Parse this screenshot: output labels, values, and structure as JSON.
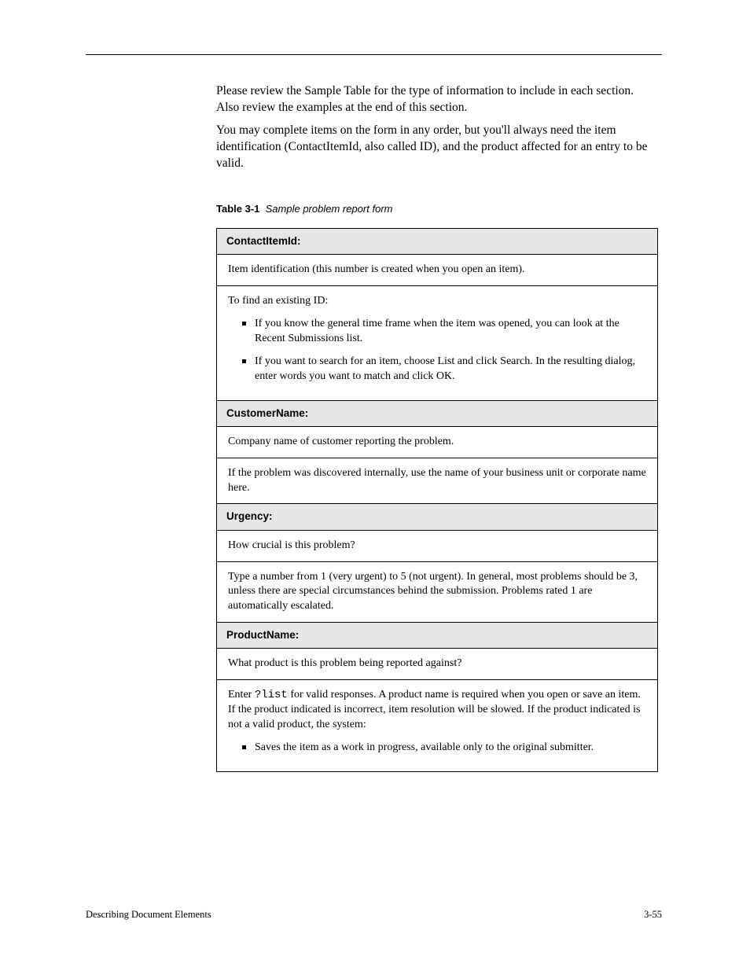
{
  "intro": {
    "p1": "Please review the Sample Table for the type of information to include in each section. Also review the examples at the end of this section.",
    "p2": "You may complete items on the form in any order, but you'll always need the item identification (ContactItemId, also called ID), and the product affected for an entry to be valid."
  },
  "tableCaption": {
    "label": "Table 3-1",
    "title": "Sample problem report form"
  },
  "sections": [
    {
      "header": "ContactItemId:",
      "rows": [
        {
          "text": "Item identification (this number is created when you open an item)."
        },
        {
          "text": "To find an existing ID:",
          "bullets": [
            "If you know the general time frame when the item was opened, you can look at the Recent Submissions list.",
            "If you want to search for an item, choose List and click Search. In the resulting dialog, enter words you want to match and click OK."
          ]
        }
      ]
    },
    {
      "header": "CustomerName:",
      "rows": [
        {
          "text": "Company name of customer reporting the problem."
        },
        {
          "text": "If the problem was discovered internally, use the name of your business unit or corporate name here."
        }
      ]
    },
    {
      "header": "Urgency:",
      "rows": [
        {
          "text": "How crucial is this problem?"
        },
        {
          "text": "Type a number from 1 (very urgent) to 5 (not urgent). In general, most problems should be 3, unless there are special circumstances behind the submission. Problems rated 1 are automatically escalated."
        }
      ]
    },
    {
      "header": "ProductName:",
      "rows": [
        {
          "text": "What product is this problem being reported against?"
        },
        {
          "html": "Enter <span class=\"code\">?list</span> for valid responses. A product name is required when you open or save an item. If the product indicated is incorrect, item resolution will be slowed. If the product indicated is not a valid product, the system:",
          "bullets": [
            "Saves the item as a work in progress, available only to the original submitter."
          ]
        }
      ]
    }
  ],
  "footer": {
    "left": "Describing Document Elements",
    "right": "3-55"
  }
}
